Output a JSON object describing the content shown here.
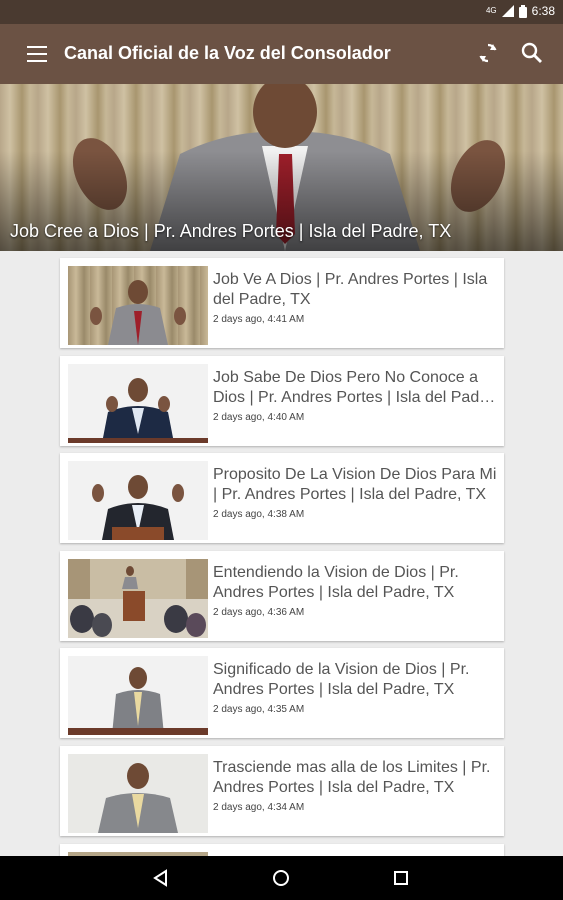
{
  "status_bar": {
    "network": "4G",
    "time": "6:38"
  },
  "app_bar": {
    "title": "Canal Oficial de la Voz del Consolador"
  },
  "featured": {
    "title": "Job Cree a Dios | Pr. Andres Portes | Isla del Padre, TX"
  },
  "videos": [
    {
      "title": "Job Ve A Dios | Pr. Andres Portes | Isla del Padre, TX",
      "time": "2 days ago, 4:41 AM"
    },
    {
      "title": "Job Sabe De Dios Pero No Conoce a Dios | Pr. Andres Portes | Isla del Padre, TX",
      "time": "2 days ago, 4:40 AM"
    },
    {
      "title": "Proposito De La Vision De Dios Para Mi | Pr. Andres Portes | Isla del Padre, TX",
      "time": "2 days ago, 4:38 AM"
    },
    {
      "title": "Entendiendo la Vision de Dios | Pr. Andres Portes | Isla del Padre, TX",
      "time": "2 days ago, 4:36 AM"
    },
    {
      "title": "Significado de la Vision de Dios | Pr. Andres Portes | Isla del Padre, TX",
      "time": "2 days ago, 4:35 AM"
    },
    {
      "title": "Trasciende mas alla de los Limites | Pr. Andres Portes | Isla del Padre, TX",
      "time": "2 days ago, 4:34 AM"
    }
  ],
  "icons": {
    "menu": "menu-icon",
    "refresh": "refresh-icon",
    "search": "search-icon",
    "back": "back-icon",
    "home": "home-icon",
    "recents": "recents-icon"
  },
  "colors": {
    "app_bar": "#6b5244",
    "status_bar": "#4a3a30",
    "background": "#ececec"
  }
}
